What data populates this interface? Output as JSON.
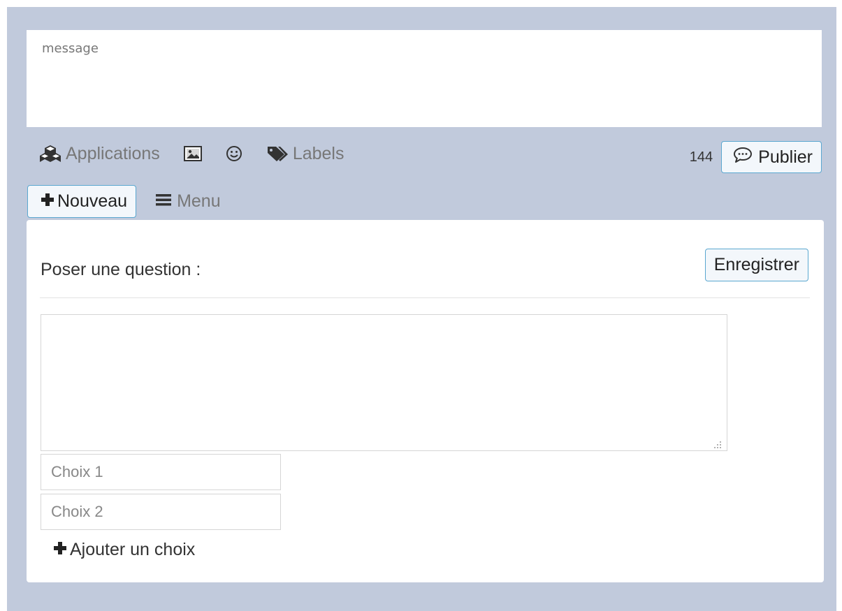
{
  "composer": {
    "message_placeholder": "message",
    "toolbar": {
      "applications_label": "Applications",
      "labels_label": "Labels",
      "char_count": "144",
      "publish_label": "Publier",
      "icons": [
        "cubes-icon",
        "image-icon",
        "smiley-icon",
        "tag-icon",
        "comment-icon"
      ]
    }
  },
  "nav": {
    "new_label": "Nouveau",
    "menu_label": "Menu"
  },
  "poll": {
    "title": "Poser une question :",
    "save_label": "Enregistrer",
    "choices": [
      {
        "placeholder": "Choix 1"
      },
      {
        "placeholder": "Choix 2"
      }
    ],
    "add_choice_label": "Ajouter un choix"
  },
  "colors": {
    "background": "#c1cadc",
    "button_border": "#5aa7d0",
    "muted_text": "#777777"
  }
}
